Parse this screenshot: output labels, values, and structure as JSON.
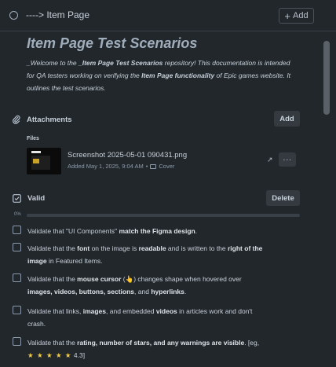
{
  "header": {
    "breadcrumb": "----> Item Page",
    "add_label": "Add"
  },
  "description": {
    "title": "Item Page Test Scenarios",
    "intro_parts": [
      "_Welcome to the ",
      "_Item Page ",
      "Test Scenarios",
      " repository! This documentation is intended for QA testers working on verifying the ",
      "Item Page functionality",
      " of Epic games website. It outlines the test scenarios."
    ]
  },
  "attachments": {
    "heading": "Attachments",
    "add_label": "Add",
    "files_label": "Files",
    "file": {
      "name": "Screenshot 2025-05-01 090431.png",
      "meta_added": "Added May 1, 2025, 9:04 AM",
      "meta_sep": "•",
      "meta_cover": "Cover",
      "more_label": "···"
    }
  },
  "checklist": {
    "heading": "Valid",
    "delete_label": "Delete",
    "progress_text": "0%",
    "progress_value": 0,
    "accent_color": "#4bce97",
    "items": [
      {
        "parts": [
          "Validate that \"UI Components\" ",
          "match the Figma design",
          "."
        ]
      },
      {
        "parts": [
          "Validate that the ",
          "font",
          " on the image is ",
          "readable",
          " and is written to the ",
          "right of the image",
          " in Featured Items."
        ]
      },
      {
        "parts": [
          "Validate that the ",
          "mouse cursor",
          " (",
          "👆",
          ") changes shape when hovered over ",
          "images, videos, buttons, sections",
          ", and ",
          "hyperlinks",
          "."
        ]
      },
      {
        "parts": [
          "Validate that links, ",
          "images",
          ", and embedded ",
          "videos",
          " in articles work and don't crash."
        ]
      },
      {
        "parts": [
          "Validate that the ",
          "rating, number of stars, and any warnings are visible",
          ". [eg, ",
          "★ ★ ★ ★ ★",
          " 4.3]"
        ]
      }
    ]
  },
  "icons": {
    "status": "circle-icon",
    "attachments": "paperclip-icon",
    "checklist": "checkbox-icon",
    "open": "open-external-icon",
    "cover": "card-icon"
  }
}
